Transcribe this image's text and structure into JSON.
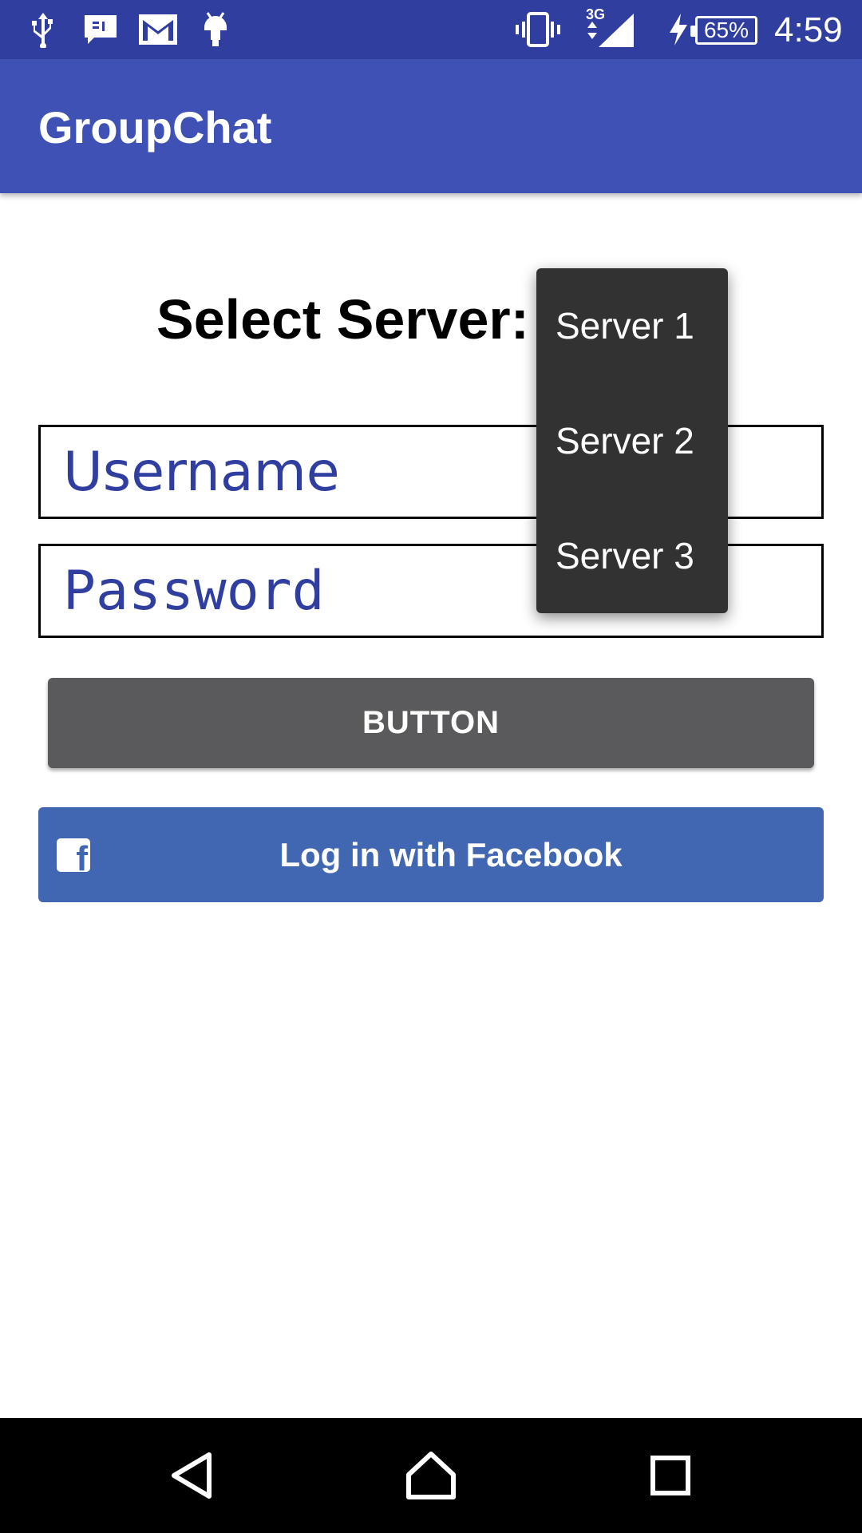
{
  "status_bar": {
    "battery": "65%",
    "time": "4:59",
    "network": "3G",
    "icons": [
      "usb-icon",
      "message-icon",
      "gmail-icon",
      "android-icon",
      "vibrate-icon",
      "signal-icon",
      "charging-icon",
      "battery-icon"
    ]
  },
  "app_bar": {
    "title": "GroupChat"
  },
  "main": {
    "select_label": "Select Server:",
    "username_placeholder": "Username",
    "password_placeholder": "Password",
    "button_label": "BUTTON",
    "facebook_label": "Log in with Facebook"
  },
  "dropdown": {
    "items": [
      "Server 1",
      "Server 2",
      "Server 3"
    ]
  },
  "nav_bar": {
    "icons": [
      "back-icon",
      "home-icon",
      "recents-icon"
    ]
  },
  "colors": {
    "status_bar": "#303F9F",
    "app_bar": "#3F51B5",
    "facebook": "#4267B2",
    "hint_text": "#303F9F",
    "dropdown_bg": "#323232"
  }
}
